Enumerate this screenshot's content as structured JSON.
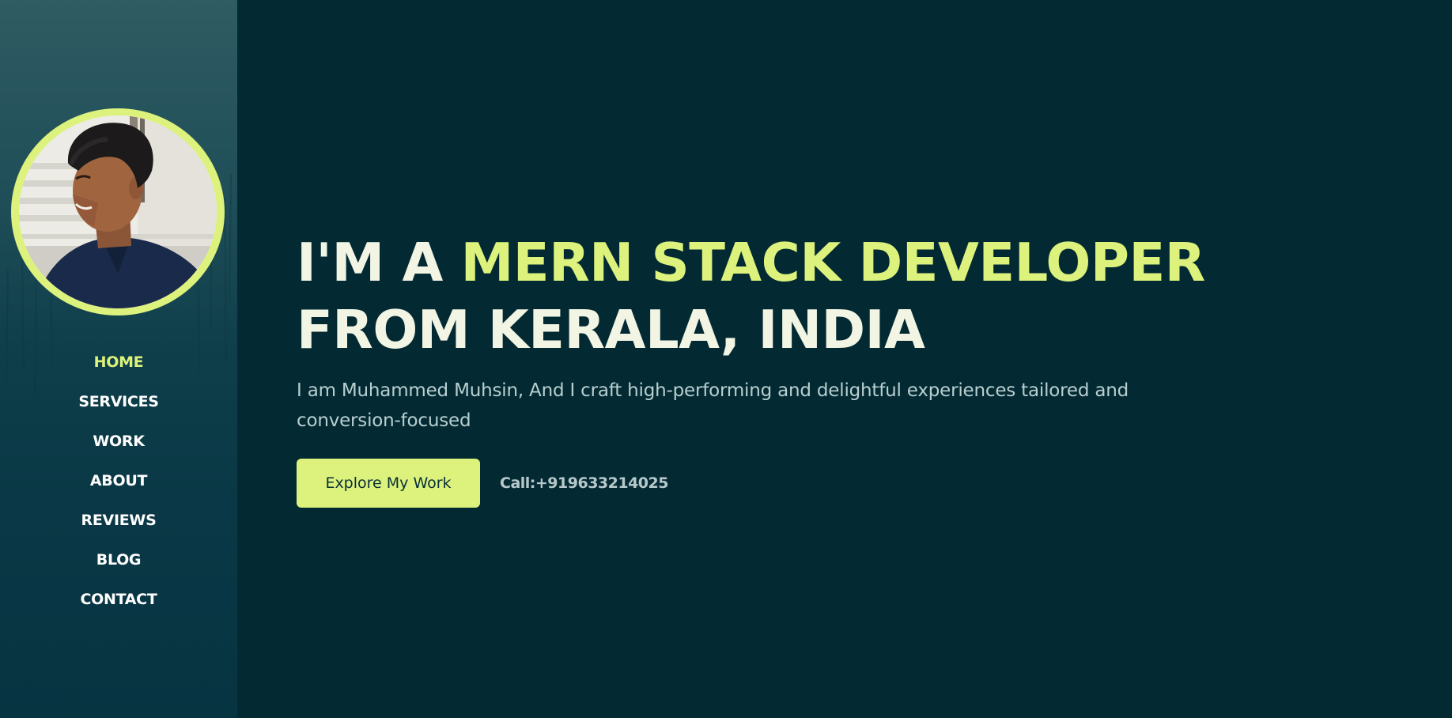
{
  "colors": {
    "accent": "#dcf27c",
    "background": "#032a33",
    "sidebar_top": "#2f5b62",
    "sidebar_bottom": "#073441",
    "text_light": "#f2f4e4",
    "text_muted": "#b8cfd0"
  },
  "sidebar": {
    "avatar_alt": "profile-photo",
    "nav": [
      {
        "label": "HOME",
        "active": true
      },
      {
        "label": "SERVICES",
        "active": false
      },
      {
        "label": "WORK",
        "active": false
      },
      {
        "label": "ABOUT",
        "active": false
      },
      {
        "label": "REVIEWS",
        "active": false
      },
      {
        "label": "BLOG",
        "active": false
      },
      {
        "label": "CONTACT",
        "active": false
      }
    ]
  },
  "hero": {
    "title_prefix": "I'M A ",
    "title_accent": "MERN STACK DEVELOPER",
    "title_line2": "FROM KERALA, INDIA",
    "description": "I am Muhammed Muhsin, And I craft high-performing and delightful experiences tailored and conversion-focused",
    "cta_label": "Explore My Work",
    "call_label": "Call:+919633214025"
  }
}
